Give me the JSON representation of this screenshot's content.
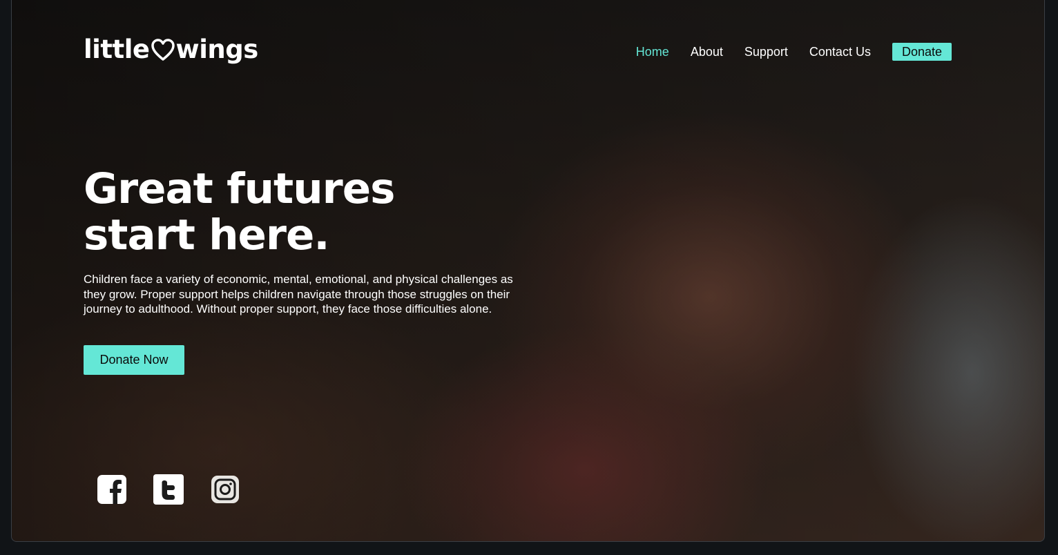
{
  "brand": {
    "left_text": "little",
    "right_text": "wings",
    "heart_icon": "heart-outline-icon"
  },
  "nav": {
    "items": [
      {
        "label": "Home",
        "active": true
      },
      {
        "label": "About",
        "active": false
      },
      {
        "label": "Support",
        "active": false
      },
      {
        "label": "Contact Us",
        "active": false
      }
    ],
    "donate_label": "Donate"
  },
  "hero": {
    "title": "Great futures start here.",
    "body": "Children face a variety of economic, mental, emotional, and physical challenges as they grow. Proper support helps children navigate through those struggles on their journey to adulthood. Without proper support, they face those difficulties alone.",
    "cta_label": "Donate Now"
  },
  "social": [
    "facebook-icon",
    "twitter-icon",
    "instagram-icon"
  ],
  "colors": {
    "accent": "#64e7d6",
    "text": "#ffffff",
    "page_bg": "#111417"
  }
}
